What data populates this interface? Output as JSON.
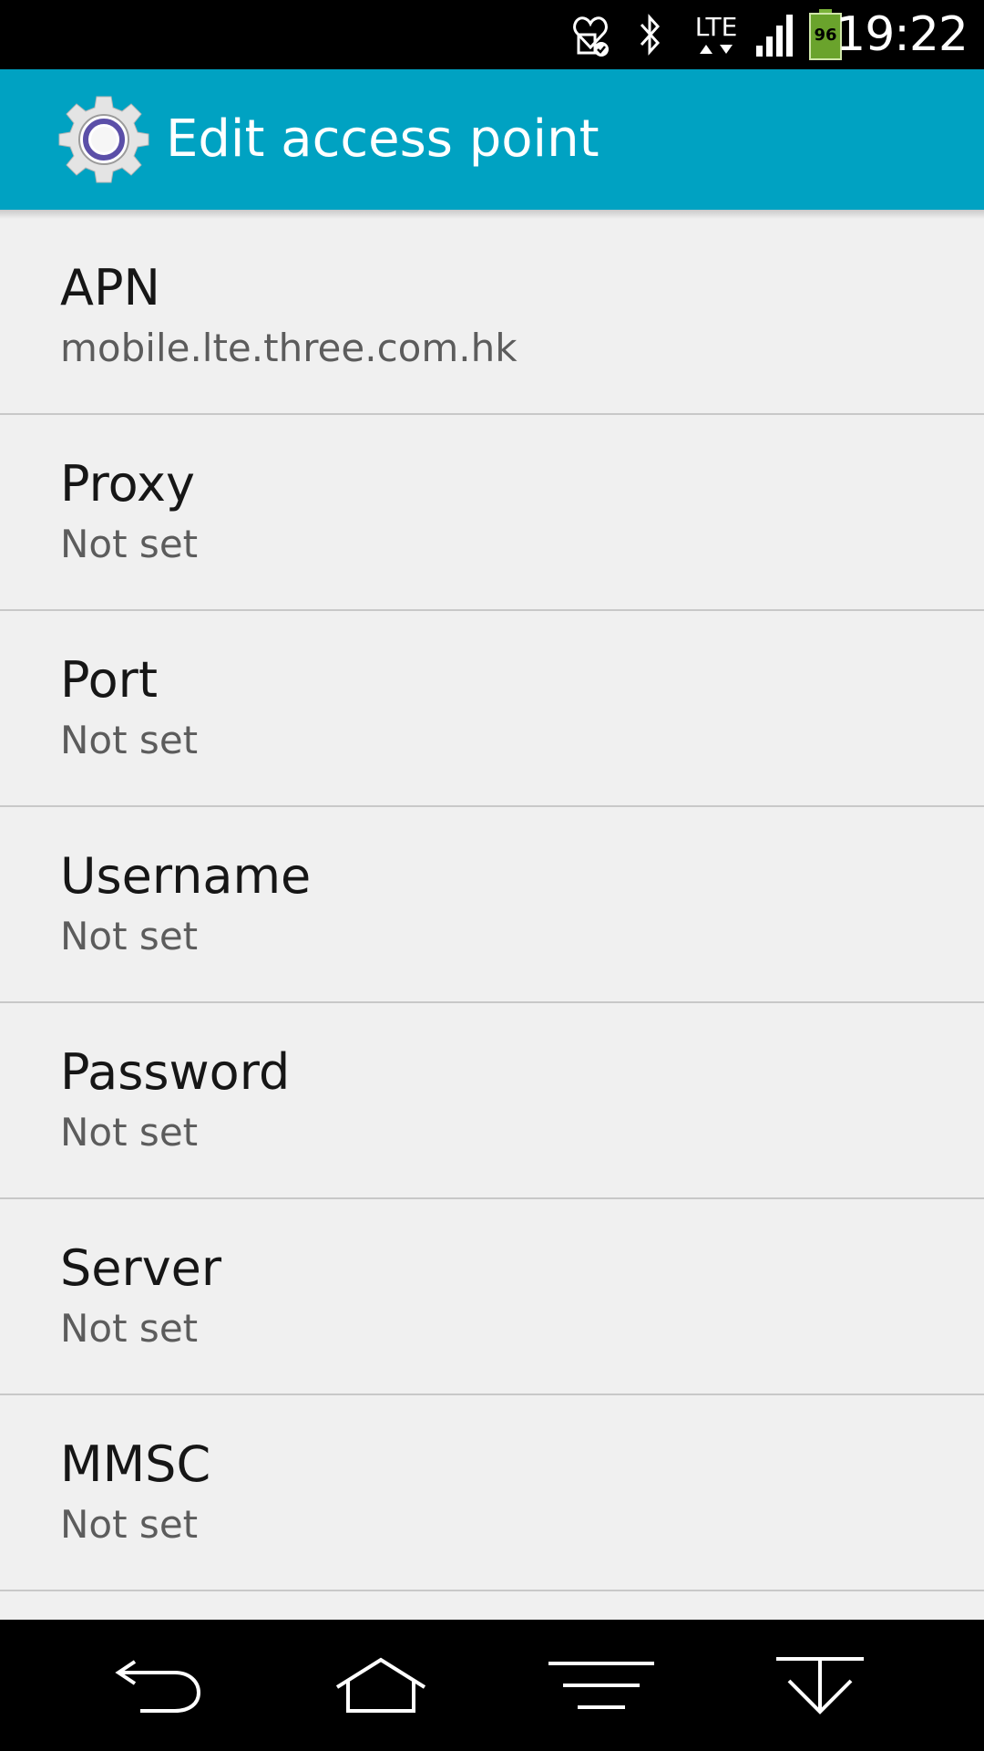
{
  "status_bar": {
    "time": "19:22",
    "network_type": "LTE",
    "battery_level": "96",
    "icons": [
      "notification-heart-icon",
      "bluetooth-icon",
      "lte-icon",
      "signal-icon",
      "battery-icon"
    ]
  },
  "action_bar": {
    "title": "Edit access point",
    "icon": "settings-gear-icon",
    "background_color": "#00a2c2"
  },
  "fields": [
    {
      "label": "APN",
      "value": "mobile.lte.three.com.hk"
    },
    {
      "label": "Proxy",
      "value": "Not set"
    },
    {
      "label": "Port",
      "value": "Not set"
    },
    {
      "label": "Username",
      "value": "Not set"
    },
    {
      "label": "Password",
      "value": "Not set"
    },
    {
      "label": "Server",
      "value": "Not set"
    },
    {
      "label": "MMSC",
      "value": "Not set"
    }
  ],
  "nav_bar": {
    "buttons": [
      "back-icon",
      "home-icon",
      "menu-icon",
      "hide-keyboard-icon"
    ]
  }
}
